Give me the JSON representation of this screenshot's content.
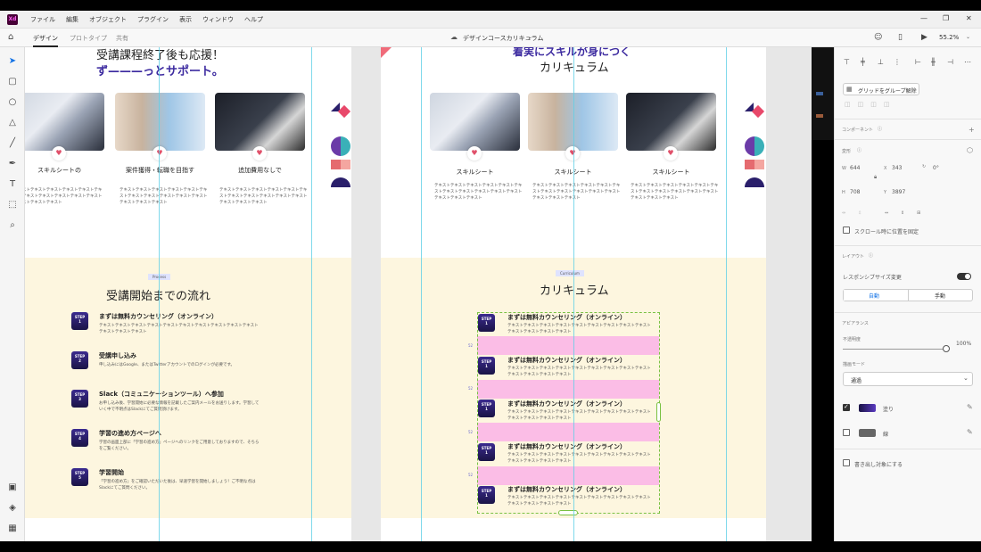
{
  "menu": [
    "ファイル",
    "編集",
    "オブジェクト",
    "プラグイン",
    "表示",
    "ウィンドウ",
    "ヘルプ"
  ],
  "app_logo": "Xd",
  "tabs": [
    "デザイン",
    "プロトタイプ",
    "共有"
  ],
  "doc_title": "デザインコースカリキュラム",
  "zoom_level": "55.2%",
  "left_artboard": {
    "hero_title": "受講課程終了後も応援！",
    "hero_sub": "ず———っとサポート。",
    "cards": [
      {
        "title": "スキルシートの",
        "body": "テキストテキストテキストテキストテキストテキストテキストテキストテキストテキストテキストテキストテキストテキスト"
      },
      {
        "title": "案件獲得・転職を目指す",
        "body": "テキストテキストテキストテキストテキストテキストテキストテキストテキストテキストテキストテキストテキストテキスト"
      },
      {
        "title": "追加費用なしで",
        "body": "テキストテキストテキストテキストテキストテキストテキストテキストテキストテキストテキストテキストテキストテキスト"
      }
    ],
    "process_badge": "Process",
    "section_title": "受講開始までの流れ",
    "steps": [
      {
        "num": "1",
        "title": "まずは無料カウンセリング（オンライン）",
        "body": "テキストテキストテキストテキストテキストテキストテキストテキストテキストテキストテキストテキストテキスト"
      },
      {
        "num": "2",
        "title": "受講申し込み",
        "body": "申し込みにはGoogle、またはTwitterアカウントでのログインが必要です。"
      },
      {
        "num": "3",
        "title": "Slack（コミュニケーションツール）へ参加",
        "body": "お申し込み後、学習開始に必要な情報を記載したご案内メールをお送りします。学習していく中で不明点はSlackにてご質問頂けます。"
      },
      {
        "num": "4",
        "title": "学習の進め方ページへ",
        "body": "学習の画面上部に「学習の進め方」ページへのリンクをご用意しておりますので、そちらをご覧ください。"
      },
      {
        "num": "5",
        "title": "学習開始",
        "body": "「学習の進め方」をご確認いただいた後は、早速学習を開始しましょう！ご不明な点はSlackにてご質問ください。"
      }
    ],
    "step_label": "STEP"
  },
  "right_artboard": {
    "hero_title_partial": "着実にスキルが身につく",
    "hero_title": "カリキュラム",
    "cards": [
      {
        "title": "スキルシート",
        "body": "テキストテキストテキストテキストテキストテキストテキストテキストテキストテキストテキストテキストテキストテキスト"
      },
      {
        "title": "スキルシート",
        "body": "テキストテキストテキストテキストテキストテキストテキストテキストテキストテキストテキストテキストテキストテキスト"
      },
      {
        "title": "スキルシート",
        "body": "テキストテキストテキストテキストテキストテキストテキストテキストテキストテキストテキストテキストテキストテキスト"
      }
    ],
    "curriculum_badge": "Curriculum",
    "section_title": "カリキュラム",
    "step_title": "まずは無料カウンセリング（オンライン）",
    "step_body": "テキストテキストテキストテキストテキストテキストテキストテキストテキストテキストテキストテキストテキスト",
    "step_num": "1",
    "spacer_label": "52"
  },
  "properties": {
    "ungroup_grid": "グリッドをグループ解除",
    "component_label": "コンポーネント",
    "transform_label": "変形",
    "w_label": "W",
    "w_value": "644",
    "x_label": "X",
    "x_value": "343",
    "rotation_value": "0°",
    "h_label": "H",
    "h_value": "708",
    "y_label": "Y",
    "y_value": "3897",
    "fix_position": "スクロール時に位置を固定",
    "layout_label": "レイアウト",
    "responsive_resize": "レスポンシブサイズ変更",
    "auto": "自動",
    "manual": "手動",
    "appearance_label": "アピアランス",
    "opacity_label": "不透明度",
    "opacity_value": "100%",
    "opacity_level": 1.0,
    "blend_label": "描画モード",
    "blend_value": "通過",
    "fill_label": "塗り",
    "stroke_label": "線",
    "export_label": "書き出し対象にする"
  },
  "colors": {
    "accent_purple": "#3d2ba0",
    "pink_spacer": "#fbbde6",
    "beige_bg": "#fdf6df",
    "guide": "#5fd0e6"
  }
}
